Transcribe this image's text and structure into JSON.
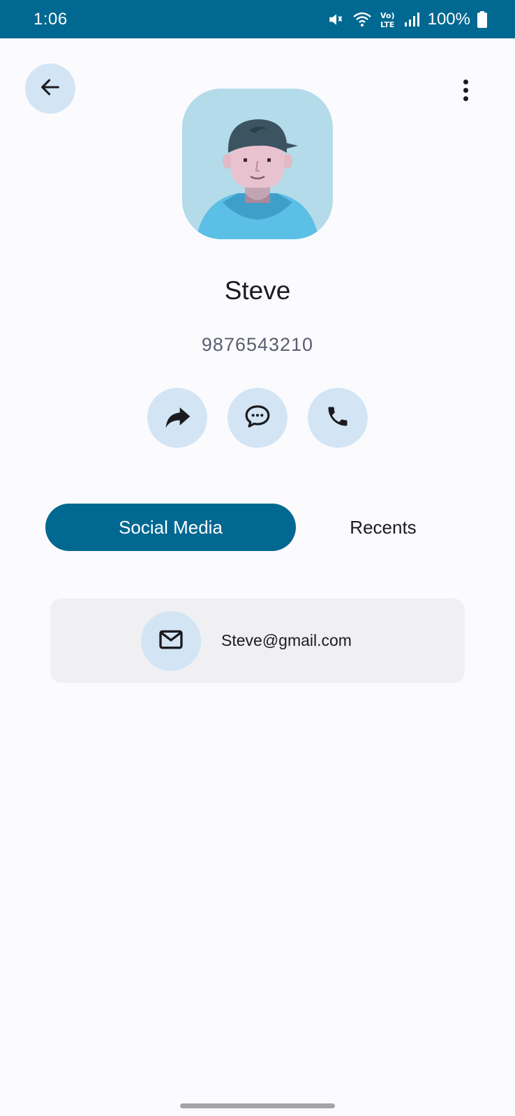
{
  "status_bar": {
    "time": "1:06",
    "battery": "100%",
    "icons": [
      "mute-icon",
      "wifi-icon",
      "volte-icon",
      "signal-icon",
      "battery-icon"
    ]
  },
  "header": {
    "back_icon": "arrow-left-icon",
    "more_icon": "more-vert-icon"
  },
  "contact": {
    "name": "Steve",
    "phone": "9876543210",
    "avatar": "avatar-illustration"
  },
  "actions": [
    {
      "icon": "share-icon"
    },
    {
      "icon": "message-icon"
    },
    {
      "icon": "phone-icon"
    }
  ],
  "tabs": [
    {
      "label": "Social Media",
      "selected": true
    },
    {
      "label": "Recents",
      "selected": false
    }
  ],
  "social_media": {
    "email": "Steve@gmail.com",
    "email_icon": "mail-icon"
  },
  "colors": {
    "primary": "#006891",
    "button_bg": "#d3e5f4",
    "avatar_bg": "#b4dbea",
    "card_bg": "#f0f0f3",
    "page_bg": "#fbfbfe"
  }
}
